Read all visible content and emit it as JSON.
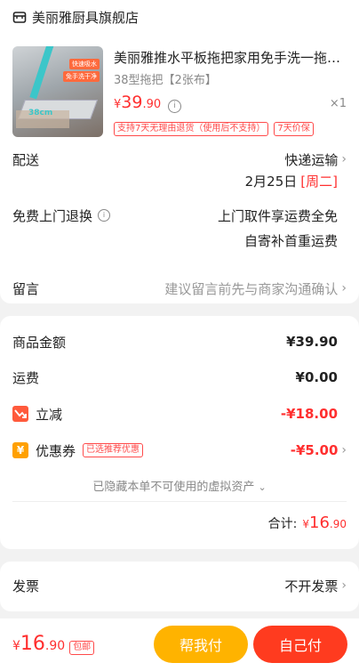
{
  "shop": {
    "name": "美丽雅厨具旗舰店"
  },
  "product": {
    "title": "美丽雅推水平板拖把家用免手洗一拖…",
    "variant": "38型拖把【2张布】",
    "price_symbol": "¥",
    "price_int": "39",
    "price_dec": ".90",
    "qty": "×1",
    "tag1": "支持7天无理由退货（使用后不支持）",
    "tag2": "7天价保",
    "thumb_tag1": "快速吸水",
    "thumb_tag2": "免手洗干净",
    "thumb_size": "38cm"
  },
  "delivery": {
    "label": "配送",
    "method": "快递运输",
    "date": "2月25日",
    "weekday": "[周二]"
  },
  "returns": {
    "label": "免费上门退换",
    "line1": "上门取件享运费全免",
    "line2": "自寄补首重运费"
  },
  "message": {
    "label": "留言",
    "placeholder": "建议留言前先与商家沟通确认"
  },
  "summary": {
    "goods_label": "商品金额",
    "goods_value": "¥39.90",
    "shipping_label": "运费",
    "shipping_value": "¥0.00",
    "discount_label": "立减",
    "discount_value": "-¥18.00",
    "coupon_label": "优惠券",
    "coupon_badge": "已选推荐优惠",
    "coupon_value": "-¥5.00",
    "hidden_assets": "已隐藏本单不可使用的虚拟资产",
    "total_label": "合计:",
    "total_symbol": "¥",
    "total_int": "16",
    "total_dec": ".90"
  },
  "invoice": {
    "label": "发票",
    "value": "不开发票"
  },
  "footer": {
    "price_symbol": "¥",
    "price_int": "16",
    "price_dec": ".90",
    "shipping_badge": "包邮",
    "help_pay": "帮我付",
    "self_pay": "自己付",
    "help_color": "#ffb300",
    "self_color": "#ff3b1f"
  }
}
